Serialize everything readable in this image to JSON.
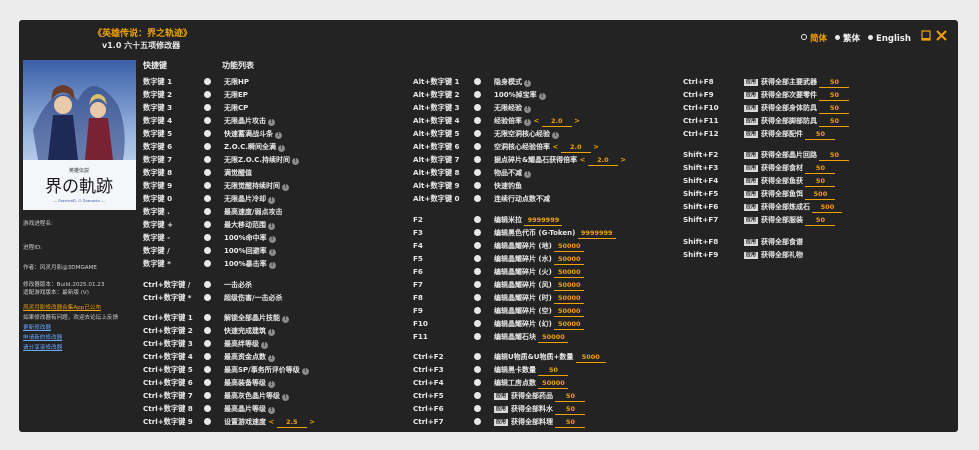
{
  "app": {
    "title": "《英雄传说：界之轨迹》",
    "subtitle": "v1.0 六十五项修改器"
  },
  "languages": [
    {
      "label": "简体",
      "active": true
    },
    {
      "label": "繁体",
      "active": false
    },
    {
      "label": "English",
      "active": false
    }
  ],
  "headers": {
    "hotkey": "快捷键",
    "features": "功能列表"
  },
  "sidebar": {
    "game_name_label": "游戏进程名:",
    "pid_label": "进程ID:",
    "author": "作者：风灵月影@3DMGAME",
    "version": "修改器版本：Build.2025.01.23",
    "game_version_note": "适配游戏版本：最新版 (V)",
    "links": [
      "风灵月影修改器合集App已公布",
      "如果修改器有问题，欢迎去论坛上反馈",
      "更新修改器",
      "申请新的修改器",
      "请分享该修改器"
    ]
  },
  "col1": [
    {
      "key": "数字键 1",
      "label": "无限HP",
      "info": false
    },
    {
      "key": "数字键 2",
      "label": "无限EP",
      "info": false
    },
    {
      "key": "数字键 3",
      "label": "无限CP",
      "info": false
    },
    {
      "key": "数字键 4",
      "label": "无限晶片攻击",
      "info": true
    },
    {
      "key": "数字键 5",
      "label": "快速蓄满战斗条",
      "info": true
    },
    {
      "key": "数字键 6",
      "label": "Z.O.C.瞬间全满",
      "info": true
    },
    {
      "key": "数字键 7",
      "label": "无限Z.O.C.持续时间",
      "info": true
    },
    {
      "key": "数字键 8",
      "label": "满觉醒值",
      "info": false
    },
    {
      "key": "数字键 9",
      "label": "无限觉醒持续时间",
      "info": true
    },
    {
      "key": "数字键 0",
      "label": "无限晶片冷却",
      "info": true
    },
    {
      "key": "数字键 .",
      "label": "最高速度/弱点攻击",
      "info": false
    },
    {
      "key": "数字键 +",
      "label": "最大移动范围",
      "info": true
    },
    {
      "key": "数字键 -",
      "label": "100%命中率",
      "info": true
    },
    {
      "key": "数字键 /",
      "label": "100%回避率",
      "info": true
    },
    {
      "key": "数字键 *",
      "label": "100%暴击率",
      "info": true
    },
    {
      "key": "Ctrl+数字键 /",
      "label": "一击必杀",
      "info": false
    },
    {
      "key": "Ctrl+数字键 *",
      "label": "超级伤害/一击必杀",
      "info": false
    },
    {
      "key": "Ctrl+数字键 1",
      "label": "解锁全部晶片技能",
      "info": true
    },
    {
      "key": "Ctrl+数字键 2",
      "label": "快速完成建筑",
      "info": true
    },
    {
      "key": "Ctrl+数字键 3",
      "label": "最高绊等级",
      "info": true
    },
    {
      "key": "Ctrl+数字键 4",
      "label": "最高资金点数",
      "info": true
    },
    {
      "key": "Ctrl+数字键 5",
      "label": "最高SP/事务所评价等级",
      "info": true
    },
    {
      "key": "Ctrl+数字键 6",
      "label": "最高装备等级",
      "info": true
    },
    {
      "key": "Ctrl+数字键 7",
      "label": "最高灰色晶片等级",
      "info": true
    },
    {
      "key": "Ctrl+数字键 8",
      "label": "最高晶片等级",
      "info": true
    },
    {
      "key": "Ctrl+数字键 9",
      "label": "设置游戏速度",
      "info": false,
      "value": "2.5"
    }
  ],
  "col2": [
    {
      "key": "Alt+数字键 1",
      "label": "隐身模式",
      "info": true
    },
    {
      "key": "Alt+数字键 2",
      "label": "100%掉宝率",
      "info": true
    },
    {
      "key": "Alt+数字键 3",
      "label": "无限经验",
      "info": true
    },
    {
      "key": "Alt+数字键 4",
      "label": "经验倍率",
      "info": true,
      "value": "2.0"
    },
    {
      "key": "Alt+数字键 5",
      "label": "无限空洞核心经验",
      "info": true
    },
    {
      "key": "Alt+数字键 6",
      "label": "空洞核心经验倍率",
      "info": false,
      "value": "2.0"
    },
    {
      "key": "Alt+数字键 7",
      "label": "据点碎片&耀晶石获得倍率",
      "info": false,
      "value": "2.0"
    },
    {
      "key": "Alt+数字键 8",
      "label": "物品不减",
      "info": true
    },
    {
      "key": "Alt+数字键 9",
      "label": "快速钓鱼",
      "info": false
    },
    {
      "key": "Alt+数字键 0",
      "label": "连续行动点数不减",
      "info": false
    },
    {
      "key": "F2",
      "label": "编辑米拉",
      "info": false,
      "value": "9999999"
    },
    {
      "key": "F3",
      "label": "编辑黑色代币 (G-Token)",
      "info": false,
      "value": "9999999"
    },
    {
      "key": "F4",
      "label": "编辑晶耀碎片 (地)",
      "info": false,
      "value": "50000"
    },
    {
      "key": "F5",
      "label": "编辑晶耀碎片 (水)",
      "info": false,
      "value": "50000"
    },
    {
      "key": "F6",
      "label": "编辑晶耀碎片 (火)",
      "info": false,
      "value": "50000"
    },
    {
      "key": "F7",
      "label": "编辑晶耀碎片 (风)",
      "info": false,
      "value": "50000"
    },
    {
      "key": "F8",
      "label": "编辑晶耀碎片 (时)",
      "info": false,
      "value": "50000"
    },
    {
      "key": "F9",
      "label": "编辑晶耀碎片 (空)",
      "info": false,
      "value": "50000"
    },
    {
      "key": "F10",
      "label": "编辑晶耀碎片 (幻)",
      "info": false,
      "value": "50000"
    },
    {
      "key": "F11",
      "label": "编辑晶耀石块",
      "info": false,
      "value": "50000"
    },
    {
      "key": "Ctrl+F2",
      "label": "编辑U物质&U物质+数量",
      "info": false,
      "value": "5000"
    },
    {
      "key": "Ctrl+F3",
      "label": "编辑黑卡数量",
      "info": false,
      "value": "50"
    },
    {
      "key": "Ctrl+F4",
      "label": "编辑工房点数",
      "info": false,
      "value": "50000"
    },
    {
      "key": "Ctrl+F5",
      "label": "获得全部药品",
      "info": false,
      "value": "50",
      "apply": "应用"
    },
    {
      "key": "Ctrl+F6",
      "label": "获得全部料水",
      "info": false,
      "value": "50",
      "apply": "应用"
    },
    {
      "key": "Ctrl+F7",
      "label": "获得全部料理",
      "info": false,
      "value": "50",
      "apply": "应用"
    }
  ],
  "col3": [
    {
      "key": "Ctrl+F8",
      "label": "获得全部主要武器",
      "value": "50",
      "apply": "应用"
    },
    {
      "key": "Ctrl+F9",
      "label": "获得全部次要零件",
      "value": "50",
      "apply": "应用"
    },
    {
      "key": "Ctrl+F10",
      "label": "获得全部身体防具",
      "value": "50",
      "apply": "应用"
    },
    {
      "key": "Ctrl+F11",
      "label": "获得全部脚部防具",
      "value": "50",
      "apply": "应用"
    },
    {
      "key": "Ctrl+F12",
      "label": "获得全部配件",
      "value": "50",
      "apply": "应用"
    },
    {
      "key": "Shift+F2",
      "label": "获得全部晶片回路",
      "value": "50",
      "apply": "应用"
    },
    {
      "key": "Shift+F3",
      "label": "获得全部食材",
      "value": "50",
      "apply": "应用"
    },
    {
      "key": "Shift+F4",
      "label": "获得全部鱼获",
      "value": "50",
      "apply": "应用"
    },
    {
      "key": "Shift+F5",
      "label": "获得全部鱼饵",
      "value": "500",
      "apply": "应用"
    },
    {
      "key": "Shift+F6",
      "label": "获得全部炼成石",
      "value": "500",
      "apply": "应用"
    },
    {
      "key": "Shift+F7",
      "label": "获得全部服装",
      "value": "50",
      "apply": "应用"
    },
    {
      "key": "Shift+F8",
      "label": "获得全部食谱",
      "apply": "应用"
    },
    {
      "key": "Shift+F9",
      "label": "获得全部礼物",
      "apply": "应用"
    }
  ],
  "colors": {
    "accent": "#f0a200",
    "bg": "#232323"
  },
  "icons": {
    "minimize": "minimize-icon",
    "close": "close-icon"
  }
}
